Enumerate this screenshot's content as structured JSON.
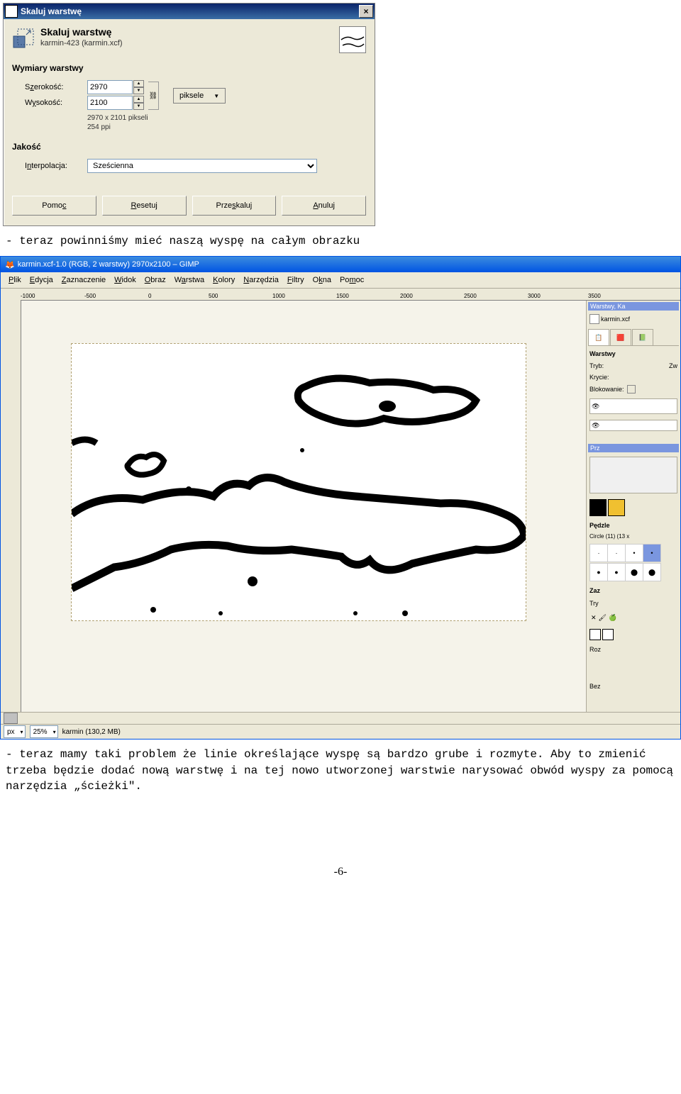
{
  "dialog": {
    "window_title": "Skaluj warstwę",
    "header_title": "Skaluj warstwę",
    "header_sub": "karmin-423 (karmin.xcf)",
    "section1": "Wymiary warstwy",
    "width_label_pre": "S",
    "width_label_u": "z",
    "width_label_post": "erokość:",
    "width_value": "2970",
    "height_label_pre": "W",
    "height_label_u": "y",
    "height_label_post": "sokość:",
    "height_value": "2100",
    "unit": "piksele",
    "info1": "2970 x 2101 pikseli",
    "info2": "254 ppi",
    "section2": "Jakość",
    "interp_label_pre": "I",
    "interp_label_u": "n",
    "interp_label_post": "terpolacja:",
    "interp_value": "Sześcienna",
    "btn_help_pre": "Pomo",
    "btn_help_u": "c",
    "btn_reset_u": "R",
    "btn_reset_post": "esetuj",
    "btn_scale_pre": "Prze",
    "btn_scale_u": "s",
    "btn_scale_post": "kaluj",
    "btn_cancel_u": "A",
    "btn_cancel_post": "nuluj"
  },
  "text1": "- teraz powinniśmy mieć naszą wyspę na całym obrazku",
  "gimp": {
    "title": "karmin.xcf-1.0 (RGB, 2 warstwy) 2970x2100 – GIMP",
    "menu": {
      "m0": "Plik",
      "m1": "Edycja",
      "m2": "Zaznaczenie",
      "m3": "Widok",
      "m4": "Obraz",
      "m5": "Warstwa",
      "m6": "Kolory",
      "m7": "Narzędzia",
      "m8": "Filtry",
      "m9": "Okna",
      "m10": "Pomoc"
    },
    "ruler": {
      "r0": "-1000",
      "r1": "-500",
      "r2": "0",
      "r3": "500",
      "r4": "1000",
      "r5": "1500",
      "r6": "2000",
      "r7": "2500",
      "r8": "3000",
      "r9": "3500"
    },
    "right": {
      "dock1_title": "Warstwy, Ka",
      "file": "karmin.xcf",
      "layers": "Warstwy",
      "mode_l": "Tryb:",
      "mode_v": "Zw",
      "opac_l": "Krycie:",
      "lock_l": "Blokowanie:",
      "prz": "Prz",
      "brush_title": "Pędzle",
      "brush_name": "Circle (11) (13 x",
      "zaz": "Zaz",
      "try": "Try",
      "roz": "Roz",
      "bez": "Bez"
    },
    "status": {
      "unit": "px",
      "zoom": "25%",
      "info": "karmin (130,2 MB)"
    }
  },
  "text2": "- teraz mamy taki problem że linie określające wyspę są bardzo grube i rozmyte. Aby to zmienić trzeba będzie dodać nową warstwę i na tej nowo utworzonej warstwie narysować obwód wyspy za pomocą narzędzia „ścieżki\".",
  "pagenum": "-6-"
}
